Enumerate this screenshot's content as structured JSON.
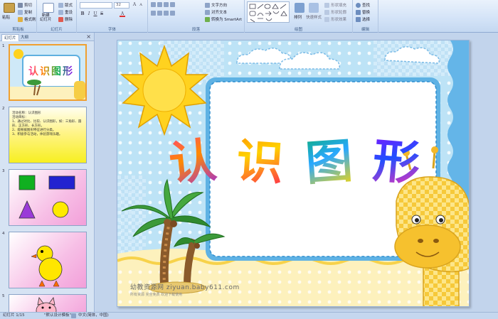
{
  "ribbon": {
    "clipboard": {
      "paste": "粘贴",
      "cut": "剪切",
      "copy": "复制",
      "format_painter": "格式刷",
      "group": "剪贴板"
    },
    "slides": {
      "new_slide": "新建\n幻灯片",
      "layout": "版式",
      "reset": "重设",
      "delete": "删除",
      "group": "幻灯片"
    },
    "font": {
      "font_size": "32",
      "group": "字体"
    },
    "paragraph": {
      "text_direction": "文字方向",
      "align_text": "对齐文本",
      "smartart": "转换为 SmartArt",
      "group": "段落"
    },
    "drawing": {
      "arrange": "排列",
      "quick_styles": "快速样式",
      "shape_fill": "形状填充",
      "shape_outline": "形状轮廓",
      "shape_effects": "形状效果",
      "group": "绘图"
    },
    "editing": {
      "find": "查找",
      "replace": "替换",
      "select": "选择",
      "group": "编辑"
    }
  },
  "panel": {
    "tabs": [
      "幻灯片",
      "大纲"
    ],
    "close": "×",
    "slide_numbers": [
      "1",
      "2",
      "3",
      "4",
      "5"
    ],
    "slide1_title": "认识图形",
    "slide2_text": [
      "活动名称：认识图形",
      "活动目标：",
      "1、通过对比、比较、认识图形，如：三角形、圆形、正方形、长方形。",
      "2、能根据图形特征进行分类。",
      "3、积极参与活动，体验游戏乐趣。"
    ]
  },
  "slide": {
    "title_chars": [
      "认",
      "识",
      "图",
      "形"
    ],
    "watermark": "幼教资源网 ziyuan.baby611.com",
    "watermark_sub": "所有资源  完全免费  欢迎下载使用"
  },
  "status": {
    "slide_count": "幻灯片 1/15",
    "theme": "\"默认设计模板\"",
    "language": "中文(简体，中国)"
  },
  "colors": {
    "title_gradients": [
      [
        "#ff2d9b",
        "#ff8a00",
        "#a02bd6"
      ],
      [
        "#ff7a00",
        "#ffd200",
        "#ff2050"
      ],
      [
        "#00b050",
        "#2aa8ff",
        "#ffd800"
      ],
      [
        "#a000ff",
        "#2050ff",
        "#ff2fb0"
      ]
    ],
    "sky": "#cfe9f8",
    "sand": "#fdf1bd"
  }
}
